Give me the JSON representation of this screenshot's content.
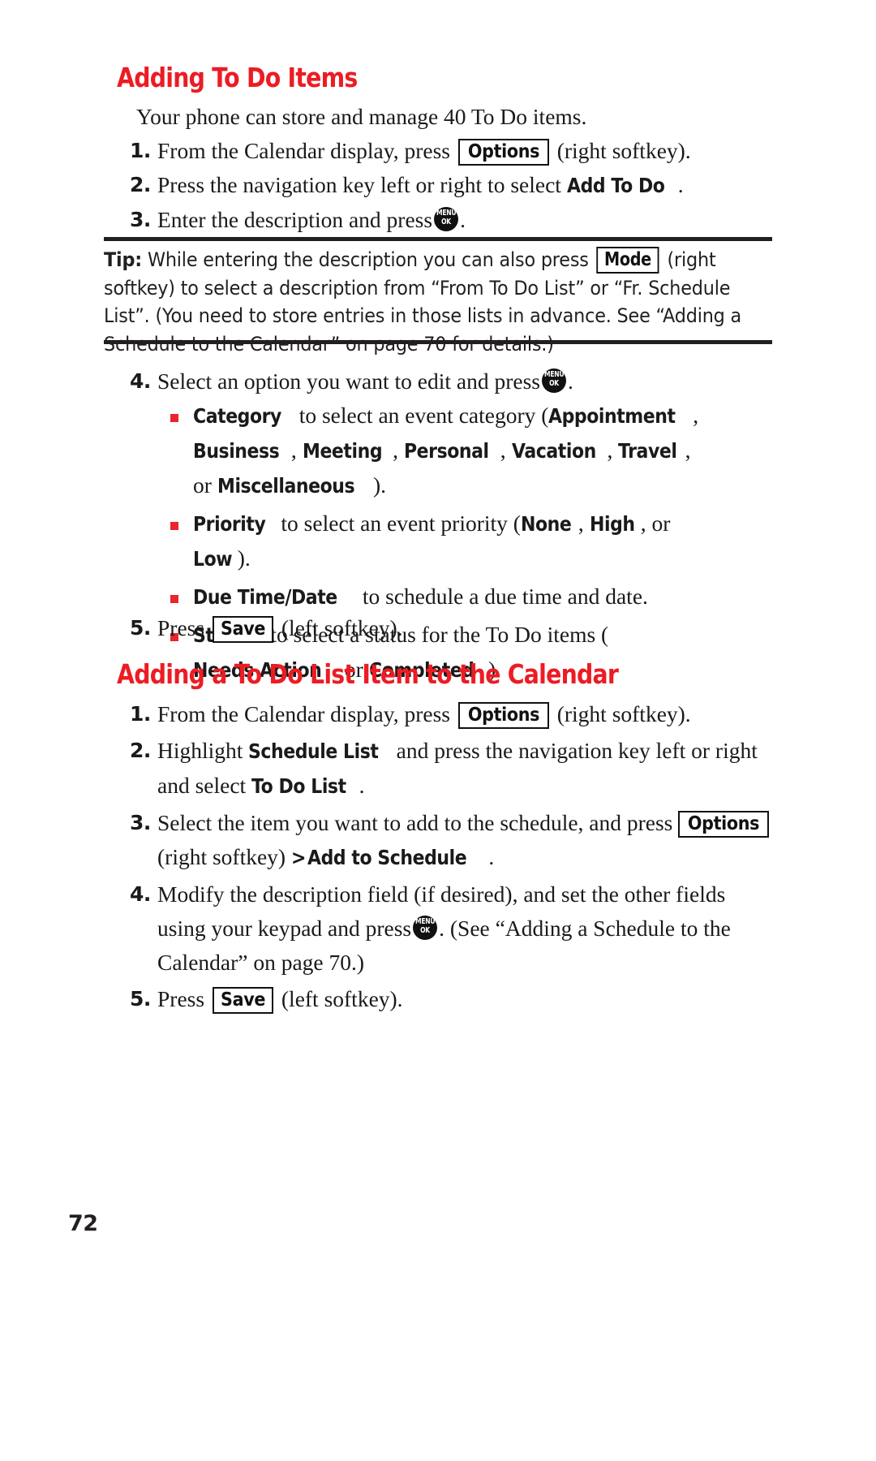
{
  "page": {
    "number": "72",
    "accent_color": "#ec1c24",
    "bullet_color": "#e8262d",
    "text_color": "#1a1a1a"
  },
  "section1": {
    "heading": "Adding To Do Items",
    "intro": "Your phone can store and manage 40 To Do items.",
    "steps": [
      {
        "num": "1.",
        "part_a": "From the Calendar display, press",
        "key": "Options",
        "part_b": "(right softkey)."
      },
      {
        "num": "2.",
        "part_a": "Press the navigation key left or right to select",
        "emphasis": "Add To Do",
        "part_b": "."
      },
      {
        "num": "3.",
        "part_a": "Enter the description and press",
        "key_icon": "menu-ok-key",
        "part_b": "."
      }
    ],
    "tip": {
      "label": "Tip:",
      "text_before_key": " While entering the description you can also press",
      "key": "Mode",
      "text_after_key": " (right softkey) to select a description from “From To Do List” or “Fr. Schedule List”. (You need to store entries in those lists in advance. See “Adding a Schedule to the Calendar” on page 70 for details.)"
    },
    "step4": {
      "num": "4.",
      "part_a": "Select an option you want to edit and press",
      "key_icon": "menu-ok-key",
      "part_b": "."
    },
    "bullets": [
      {
        "lead": "Category",
        "text": " to select an event category (",
        "options": [
          "Appointment",
          "Business",
          "Meeting",
          "Personal",
          "Vacation",
          "Travel"
        ],
        "conjunction": ", or ",
        "last_option": "Miscellaneous",
        "tail": ")."
      },
      {
        "lead": "Priority",
        "text": " to select an event priority (",
        "options": [
          "None",
          "High"
        ],
        "conjunction": ", or ",
        "last_option": "Low",
        "tail": ")."
      },
      {
        "lead": "Due Time/Date",
        "text": " to schedule a due time and date.",
        "options": [],
        "conjunction": "",
        "last_option": "",
        "tail": ""
      },
      {
        "lead": "Status",
        "text": " to select a status for the To Do items (",
        "options": [
          "Needs Action"
        ],
        "conjunction": " or ",
        "last_option": "Completed",
        "tail": ")."
      }
    ],
    "step5": {
      "num": "5.",
      "part_a": "Press",
      "key": "Save",
      "part_b": "(left softkey)."
    }
  },
  "section2": {
    "heading": "Adding a To Do List Item to the Calendar",
    "steps": [
      {
        "num": "1.",
        "part_a": "From the Calendar display, press",
        "key": "Options",
        "part_b": "(right softkey)."
      },
      {
        "num": "2.",
        "part_a": "Highlight",
        "emphasis_1": "Schedule List",
        "part_b": "and press the navigation key left or right and select",
        "emphasis_2": "To Do List",
        "part_c": "."
      },
      {
        "num": "3.",
        "part_a": "Select the item you want to add to the schedule, and press",
        "key": "Options",
        "part_b": "(right softkey)",
        "arrow": ">",
        "emphasis": "Add to Schedule",
        "part_c": "."
      },
      {
        "num": "4.",
        "part_a": "Modify the description field (if desired), and set the other fields using your keypad and press",
        "key_icon": "menu-ok-key",
        "part_b": ". (See “Adding a Schedule to the Calendar” on page 70.)"
      },
      {
        "num": "5.",
        "part_a": "Press",
        "key": "Save",
        "part_b": "(left softkey)."
      }
    ]
  }
}
